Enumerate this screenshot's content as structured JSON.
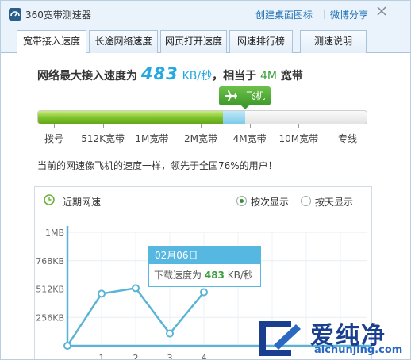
{
  "window": {
    "app_title": "360宽带测速器",
    "links": {
      "create_shortcut": "创建桌面图标",
      "separator": "|",
      "weibo_share": "微博分享"
    }
  },
  "tabs": [
    {
      "label": "宽带接入速度",
      "active": true
    },
    {
      "label": "长途网络速度",
      "active": false
    },
    {
      "label": "网页打开速度",
      "active": false
    },
    {
      "label": "网速排行榜",
      "active": false
    },
    {
      "label": "测速说明",
      "active": false
    }
  ],
  "result": {
    "prefix": "网络最大接入速度为",
    "speed_value": "483",
    "speed_unit": "KB/秒",
    "middle": "，相当于",
    "bandwidth": "4M",
    "suffix": "宽带"
  },
  "speed_bar": {
    "badge_label": "飞机",
    "badge_icon": "airplane-icon",
    "progress_fraction": 0.63,
    "ticks": [
      "拨号",
      "512K宽带",
      "1M宽带",
      "2M宽带",
      "4M宽带",
      "10M宽带",
      "专线"
    ],
    "colors": {
      "fill": "#7cc12a",
      "badge": "#4fa832",
      "accent": "#25a9e0"
    }
  },
  "comparison_text": "当前的网速像飞机的速度一样，领先于全国76%的用户！",
  "history_panel": {
    "title": "近期网速",
    "title_icon": "clock-icon",
    "view_options": [
      {
        "label": "按次显示",
        "selected": true
      },
      {
        "label": "按天显示",
        "selected": false
      }
    ]
  },
  "chart_data": {
    "type": "line",
    "title": "",
    "xlabel": "",
    "ylabel": "",
    "x": [
      0,
      1,
      2,
      3,
      4
    ],
    "x_tick_labels": [
      "1",
      "2",
      "3",
      "4"
    ],
    "y_tick_labels": [
      "1MB",
      "768KB",
      "512KB",
      "256KB"
    ],
    "y_tick_values": [
      1024,
      768,
      512,
      256
    ],
    "ylim": [
      0,
      1024
    ],
    "series": [
      {
        "values": [
          0,
          470,
          520,
          110,
          483
        ]
      }
    ],
    "grid": true,
    "line_color": "#5ab4d6"
  },
  "tooltip": {
    "date": "02月06日",
    "label": "下载速度为",
    "value": "483",
    "unit": "KB/秒"
  },
  "watermark": {
    "brand": "爱纯净",
    "url": "aichunjing.com"
  }
}
